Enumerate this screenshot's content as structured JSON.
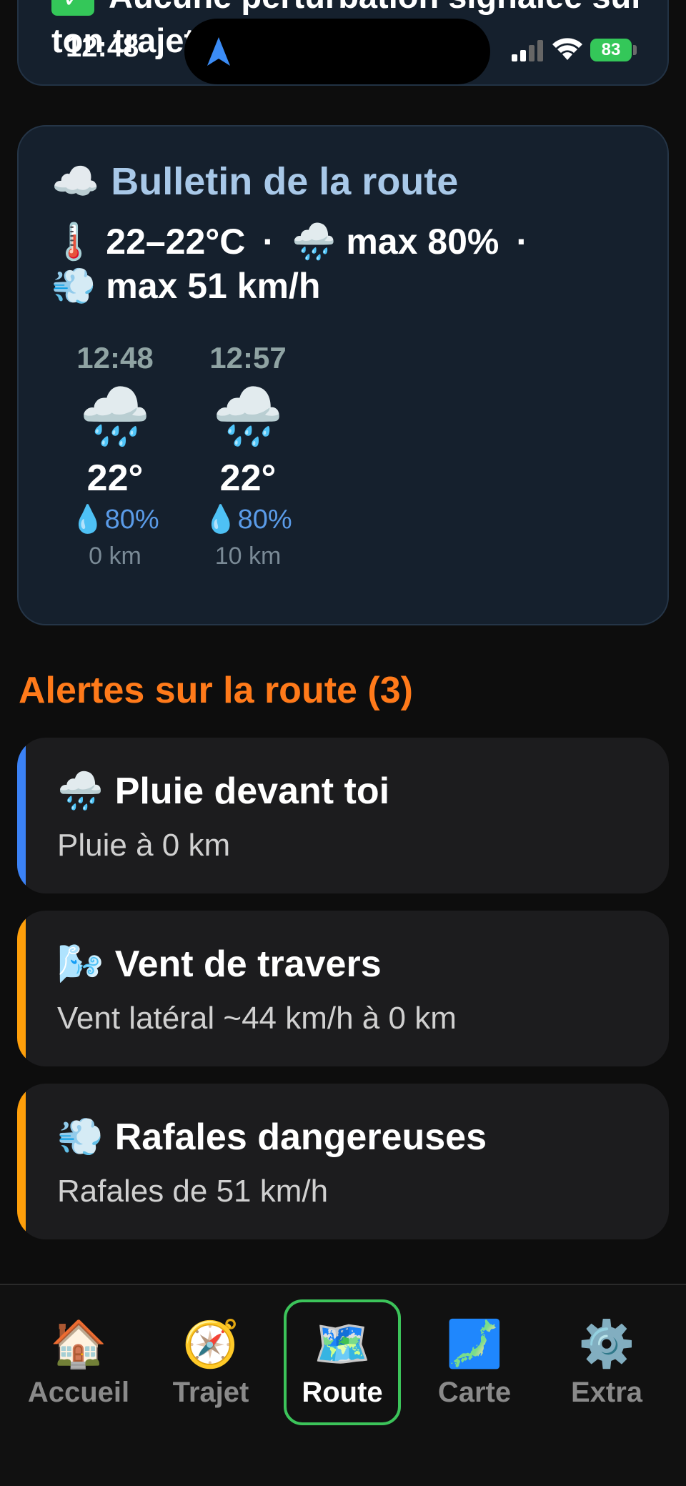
{
  "status_bar": {
    "time": "12:48",
    "battery": "83"
  },
  "top_card": {
    "text": "Aucune perturbation signalée sur ton trajet"
  },
  "bulletin": {
    "title": "Bulletin de la route",
    "title_icon": "☁️",
    "temp_icon": "🌡️",
    "temp_range": "22–22°C",
    "rain_icon": "🌧️",
    "rain_max": "max 80%",
    "wind_icon": "💨",
    "wind_max": "max 51 km/h",
    "separator": "·",
    "hours": [
      {
        "time": "12:48",
        "icon": "🌧️",
        "temp": "22°",
        "rain": "80%",
        "distance": "0 km"
      },
      {
        "time": "12:57",
        "icon": "🌧️",
        "temp": "22°",
        "rain": "80%",
        "distance": "10 km"
      }
    ],
    "rain_drop_icon": "💧"
  },
  "alerts": {
    "title": "Alertes sur la route (3)",
    "items": [
      {
        "icon": "🌧️",
        "title": "Pluie devant toi",
        "desc": "Pluie à 0 km",
        "color": "#3b82f6"
      },
      {
        "icon": "🌬️",
        "title": "Vent de travers",
        "desc": "Vent latéral ~44 km/h à 0 km",
        "color": "#ff9f0a"
      },
      {
        "icon": "💨",
        "title": "Rafales dangereuses",
        "desc": "Rafales de 51 km/h",
        "color": "#ff9f0a"
      }
    ]
  },
  "tabs": [
    {
      "label": "Accueil",
      "icon": "🏠",
      "active": false
    },
    {
      "label": "Trajet",
      "icon": "🧭",
      "active": false
    },
    {
      "label": "Route",
      "icon": "🗺️",
      "active": true
    },
    {
      "label": "Carte",
      "icon": "🗾",
      "active": false
    },
    {
      "label": "Extra",
      "icon": "⚙️",
      "active": false
    }
  ],
  "colors": {
    "accent_green": "#3cc45a",
    "alert_orange": "#ff7a1a",
    "title_blue": "#a8c8e8"
  }
}
